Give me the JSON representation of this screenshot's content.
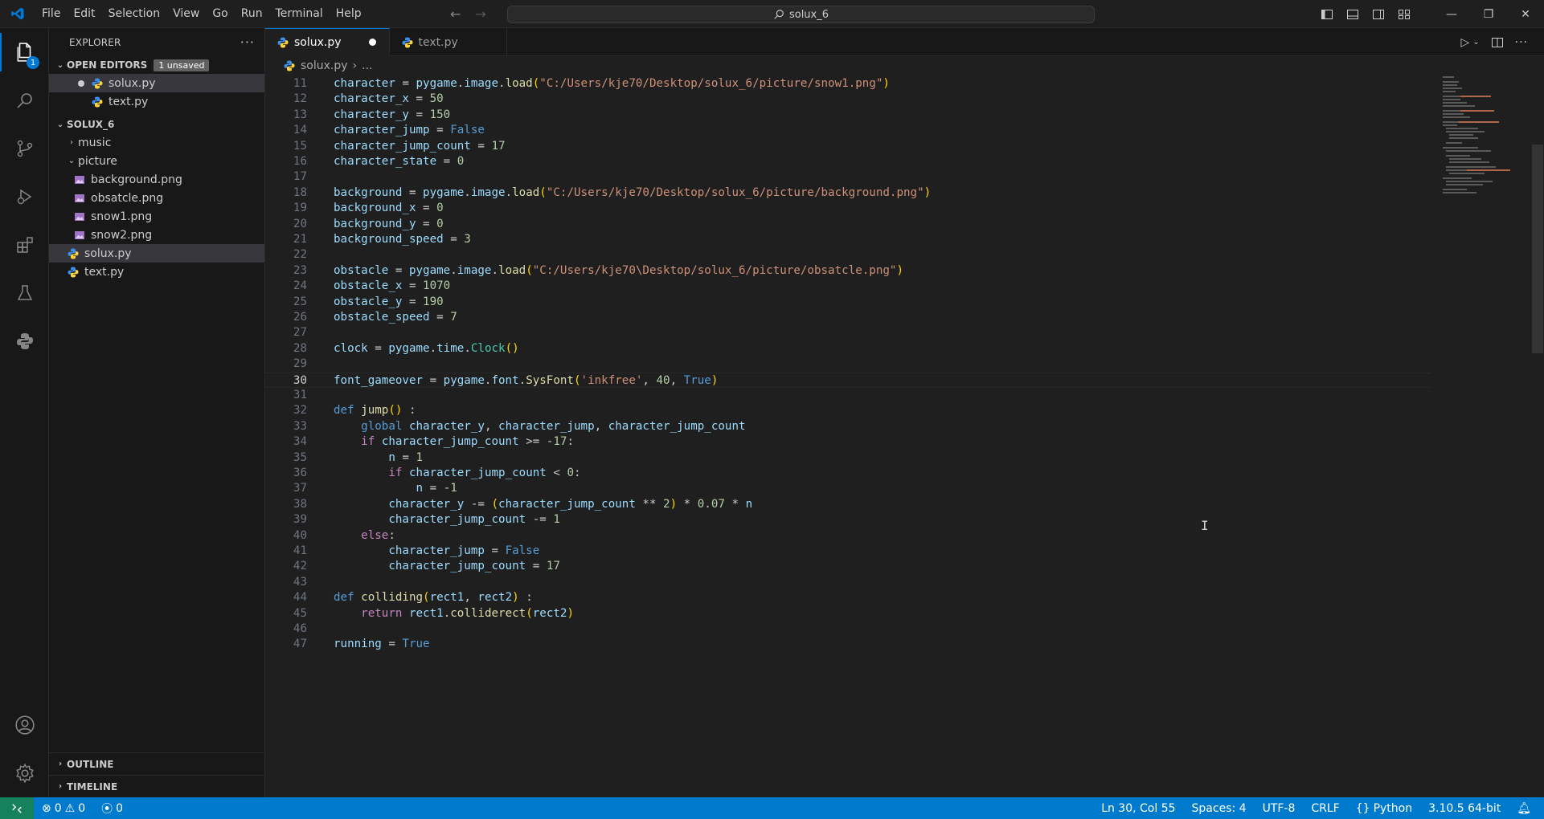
{
  "menu": [
    "File",
    "Edit",
    "Selection",
    "View",
    "Go",
    "Run",
    "Terminal",
    "Help"
  ],
  "search": {
    "text": "solux_6"
  },
  "explorer": {
    "title": "EXPLORER",
    "open_editors": {
      "label": "OPEN EDITORS",
      "badge": "1 unsaved",
      "items": [
        "solux.py",
        "text.py"
      ]
    },
    "folder": {
      "label": "SOLUX_6",
      "items": [
        {
          "name": "music",
          "type": "folder-collapsed"
        },
        {
          "name": "picture",
          "type": "folder-expanded"
        },
        {
          "name": "background.png",
          "type": "png"
        },
        {
          "name": "obsatcle.png",
          "type": "png"
        },
        {
          "name": "snow1.png",
          "type": "png"
        },
        {
          "name": "snow2.png",
          "type": "png"
        },
        {
          "name": "solux.py",
          "type": "py"
        },
        {
          "name": "text.py",
          "type": "py"
        }
      ]
    },
    "outline": "OUTLINE",
    "timeline": "TIMELINE"
  },
  "tabs": [
    {
      "label": "solux.py",
      "active": true,
      "modified": true
    },
    {
      "label": "text.py",
      "active": false,
      "modified": false
    }
  ],
  "breadcrumb": {
    "file": "solux.py",
    "rest": "..."
  },
  "activity_badge": "1",
  "editor": {
    "current_line": 30,
    "lines": [
      {
        "n": "11",
        "t": [
          [
            "v",
            "character"
          ],
          [
            "o",
            " = "
          ],
          [
            "v",
            "pygame"
          ],
          [
            "o",
            "."
          ],
          [
            "v",
            "image"
          ],
          [
            "o",
            "."
          ],
          [
            "f",
            "load"
          ],
          [
            "b1",
            "("
          ],
          [
            "s",
            "\"C:/Users/kje70/Desktop/solux_6/picture/snow1.png\""
          ],
          [
            "b1",
            ")"
          ]
        ]
      },
      {
        "n": "12",
        "t": [
          [
            "v",
            "character_x"
          ],
          [
            "o",
            " = "
          ],
          [
            "n",
            "50"
          ]
        ]
      },
      {
        "n": "13",
        "t": [
          [
            "v",
            "character_y"
          ],
          [
            "o",
            " = "
          ],
          [
            "n",
            "150"
          ]
        ]
      },
      {
        "n": "14",
        "t": [
          [
            "v",
            "character_jump"
          ],
          [
            "o",
            " = "
          ],
          [
            "k",
            "False"
          ]
        ]
      },
      {
        "n": "15",
        "t": [
          [
            "v",
            "character_jump_count"
          ],
          [
            "o",
            " = "
          ],
          [
            "n",
            "17"
          ]
        ]
      },
      {
        "n": "16",
        "t": [
          [
            "v",
            "character_state"
          ],
          [
            "o",
            " = "
          ],
          [
            "n",
            "0"
          ]
        ]
      },
      {
        "n": "17",
        "t": []
      },
      {
        "n": "18",
        "t": [
          [
            "v",
            "background"
          ],
          [
            "o",
            " = "
          ],
          [
            "v",
            "pygame"
          ],
          [
            "o",
            "."
          ],
          [
            "v",
            "image"
          ],
          [
            "o",
            "."
          ],
          [
            "f",
            "load"
          ],
          [
            "b1",
            "("
          ],
          [
            "s",
            "\"C:/Users/kje70/Desktop/solux_6/picture/background.png\""
          ],
          [
            "b1",
            ")"
          ]
        ]
      },
      {
        "n": "19",
        "t": [
          [
            "v",
            "background_x"
          ],
          [
            "o",
            " = "
          ],
          [
            "n",
            "0"
          ]
        ]
      },
      {
        "n": "20",
        "t": [
          [
            "v",
            "background_y"
          ],
          [
            "o",
            " = "
          ],
          [
            "n",
            "0"
          ]
        ]
      },
      {
        "n": "21",
        "t": [
          [
            "v",
            "background_speed"
          ],
          [
            "o",
            " = "
          ],
          [
            "n",
            "3"
          ]
        ]
      },
      {
        "n": "22",
        "t": []
      },
      {
        "n": "23",
        "t": [
          [
            "v",
            "obstacle"
          ],
          [
            "o",
            " = "
          ],
          [
            "v",
            "pygame"
          ],
          [
            "o",
            "."
          ],
          [
            "v",
            "image"
          ],
          [
            "o",
            "."
          ],
          [
            "f",
            "load"
          ],
          [
            "b1",
            "("
          ],
          [
            "s",
            "\"C:/Users/kje70\\Desktop/solux_6/picture/obsatcle.png\""
          ],
          [
            "b1",
            ")"
          ]
        ]
      },
      {
        "n": "24",
        "t": [
          [
            "v",
            "obstacle_x"
          ],
          [
            "o",
            " = "
          ],
          [
            "n",
            "1070"
          ]
        ]
      },
      {
        "n": "25",
        "t": [
          [
            "v",
            "obstacle_y"
          ],
          [
            "o",
            " = "
          ],
          [
            "n",
            "190"
          ]
        ]
      },
      {
        "n": "26",
        "t": [
          [
            "v",
            "obstacle_speed"
          ],
          [
            "o",
            " = "
          ],
          [
            "n",
            "7"
          ]
        ]
      },
      {
        "n": "27",
        "t": []
      },
      {
        "n": "28",
        "t": [
          [
            "v",
            "clock"
          ],
          [
            "o",
            " = "
          ],
          [
            "v",
            "pygame"
          ],
          [
            "o",
            "."
          ],
          [
            "v",
            "time"
          ],
          [
            "o",
            "."
          ],
          [
            "c",
            "Clock"
          ],
          [
            "b1",
            "()"
          ]
        ]
      },
      {
        "n": "29",
        "t": []
      },
      {
        "n": "30",
        "t": [
          [
            "v",
            "font_gameover"
          ],
          [
            "o",
            " = "
          ],
          [
            "v",
            "pygame"
          ],
          [
            "o",
            "."
          ],
          [
            "v",
            "font"
          ],
          [
            "o",
            "."
          ],
          [
            "f",
            "SysFont"
          ],
          [
            "b1",
            "("
          ],
          [
            "s",
            "'inkfree'"
          ],
          [
            "o",
            ", "
          ],
          [
            "n",
            "40"
          ],
          [
            "o",
            ", "
          ],
          [
            "k",
            "True"
          ],
          [
            "b1",
            ")"
          ]
        ]
      },
      {
        "n": "31",
        "t": []
      },
      {
        "n": "32",
        "t": [
          [
            "k",
            "def"
          ],
          [
            "o",
            " "
          ],
          [
            "f",
            "jump"
          ],
          [
            "b1",
            "()"
          ],
          [
            "o",
            " :"
          ]
        ]
      },
      {
        "n": "33",
        "t": [
          [
            "o",
            "    "
          ],
          [
            "k",
            "global"
          ],
          [
            "o",
            " "
          ],
          [
            "v",
            "character_y"
          ],
          [
            "o",
            ", "
          ],
          [
            "v",
            "character_jump"
          ],
          [
            "o",
            ", "
          ],
          [
            "v",
            "character_jump_count"
          ]
        ]
      },
      {
        "n": "34",
        "t": [
          [
            "o",
            "    "
          ],
          [
            "x",
            "if"
          ],
          [
            "o",
            " "
          ],
          [
            "v",
            "character_jump_count"
          ],
          [
            "o",
            " >= -"
          ],
          [
            "n",
            "17"
          ],
          [
            "o",
            ":"
          ]
        ]
      },
      {
        "n": "35",
        "t": [
          [
            "o",
            "        "
          ],
          [
            "v",
            "n"
          ],
          [
            "o",
            " = "
          ],
          [
            "n",
            "1"
          ]
        ]
      },
      {
        "n": "36",
        "t": [
          [
            "o",
            "        "
          ],
          [
            "x",
            "if"
          ],
          [
            "o",
            " "
          ],
          [
            "v",
            "character_jump_count"
          ],
          [
            "o",
            " < "
          ],
          [
            "n",
            "0"
          ],
          [
            "o",
            ":"
          ]
        ]
      },
      {
        "n": "37",
        "t": [
          [
            "o",
            "            "
          ],
          [
            "v",
            "n"
          ],
          [
            "o",
            " = -"
          ],
          [
            "n",
            "1"
          ]
        ]
      },
      {
        "n": "38",
        "t": [
          [
            "o",
            "        "
          ],
          [
            "v",
            "character_y"
          ],
          [
            "o",
            " -= "
          ],
          [
            "b1",
            "("
          ],
          [
            "v",
            "character_jump_count"
          ],
          [
            "o",
            " ** "
          ],
          [
            "n",
            "2"
          ],
          [
            "b1",
            ")"
          ],
          [
            "o",
            " * "
          ],
          [
            "n",
            "0.07"
          ],
          [
            "o",
            " * "
          ],
          [
            "v",
            "n"
          ]
        ]
      },
      {
        "n": "39",
        "t": [
          [
            "o",
            "        "
          ],
          [
            "v",
            "character_jump_count"
          ],
          [
            "o",
            " -= "
          ],
          [
            "n",
            "1"
          ]
        ]
      },
      {
        "n": "40",
        "t": [
          [
            "o",
            "    "
          ],
          [
            "x",
            "else"
          ],
          [
            "o",
            ":"
          ]
        ]
      },
      {
        "n": "41",
        "t": [
          [
            "o",
            "        "
          ],
          [
            "v",
            "character_jump"
          ],
          [
            "o",
            " = "
          ],
          [
            "k",
            "False"
          ]
        ]
      },
      {
        "n": "42",
        "t": [
          [
            "o",
            "        "
          ],
          [
            "v",
            "character_jump_count"
          ],
          [
            "o",
            " = "
          ],
          [
            "n",
            "17"
          ]
        ]
      },
      {
        "n": "43",
        "t": []
      },
      {
        "n": "44",
        "t": [
          [
            "k",
            "def"
          ],
          [
            "o",
            " "
          ],
          [
            "f",
            "colliding"
          ],
          [
            "b1",
            "("
          ],
          [
            "v",
            "rect1"
          ],
          [
            "o",
            ", "
          ],
          [
            "v",
            "rect2"
          ],
          [
            "b1",
            ")"
          ],
          [
            "o",
            " :"
          ]
        ]
      },
      {
        "n": "45",
        "t": [
          [
            "o",
            "    "
          ],
          [
            "x",
            "return"
          ],
          [
            "o",
            " "
          ],
          [
            "v",
            "rect1"
          ],
          [
            "o",
            "."
          ],
          [
            "f",
            "colliderect"
          ],
          [
            "b1",
            "("
          ],
          [
            "v",
            "rect2"
          ],
          [
            "b1",
            ")"
          ]
        ]
      },
      {
        "n": "46",
        "t": []
      },
      {
        "n": "47",
        "t": [
          [
            "v",
            "running"
          ],
          [
            "o",
            " = "
          ],
          [
            "k",
            "True"
          ]
        ]
      }
    ]
  },
  "status": {
    "errors": "0",
    "warnings": "0",
    "ports": "0",
    "position": "Ln 30, Col 55",
    "spaces": "Spaces: 4",
    "encoding": "UTF-8",
    "eol": "CRLF",
    "language": "Python",
    "interpreter": "3.10.5 64-bit"
  },
  "colors": {
    "accent": "#0078d4",
    "statusbar": "#007acc",
    "remote": "#16825d"
  }
}
